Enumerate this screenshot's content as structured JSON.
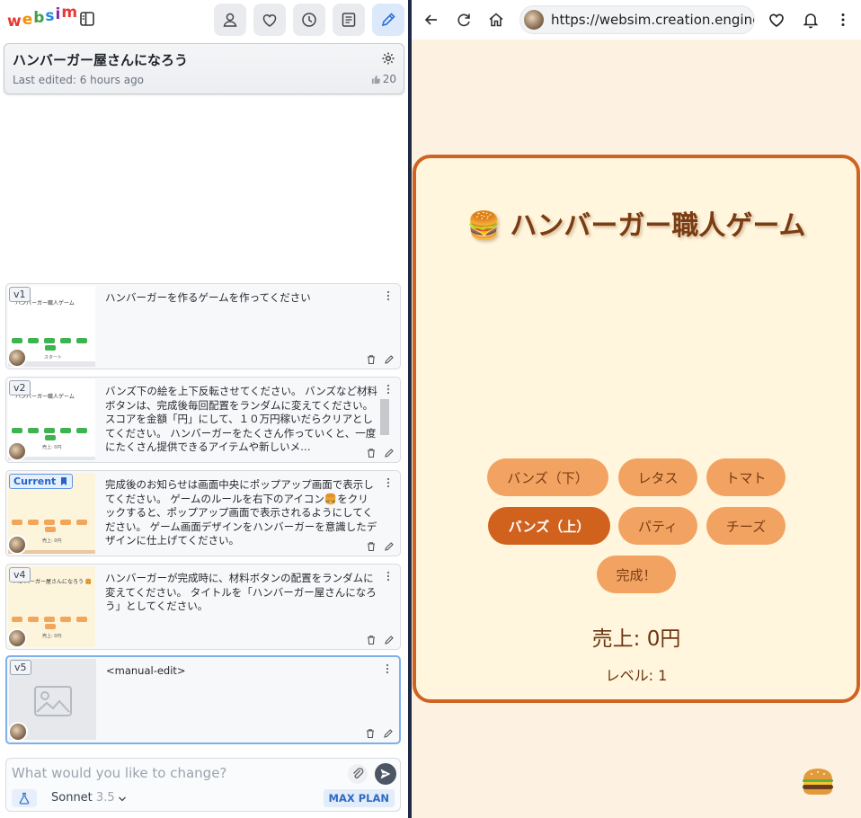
{
  "left": {
    "logo": [
      "w",
      "e",
      "b",
      "s",
      "i",
      "m"
    ],
    "project": {
      "title": "ハンバーガー屋さんになろう",
      "edited": "Last edited: 6 hours ago",
      "likes": "20"
    },
    "versions": [
      {
        "badge": "v1",
        "text": "ハンバーガーを作るゲームを作ってください",
        "thumb_title": "ハンバーガー職人ゲーム",
        "thumb_small": "スタート"
      },
      {
        "badge": "v2",
        "text": "バンズ下の絵を上下反転させてください。 バンズなど材料ボタンは、完成後毎回配置をランダムに変えてください。 スコアを金額「円」にして、１０万円稼いだらクリアとしてください。 ハンバーガーをたくさん作っていくと、一度にたくさん提供できるアイテムや新しいメ…",
        "thumb_title": "ハンバーガー職人ゲーム",
        "thumb_small": "売上: 0円"
      },
      {
        "badge": "Current",
        "text": "完成後のお知らせは画面中央にポップアップ画面で表示してください。 ゲームのルールを右下のアイコン🍔をクリックすると、ポップアップ画面で表示されるようにしてください。 ゲーム画面デザインをハンバーガーを意識したデザインに仕上げてください。",
        "thumb_title": "",
        "thumb_small": "売上: 0円"
      },
      {
        "badge": "v4",
        "text": "ハンバーガーが完成時に、材料ボタンの配置をランダムに変えてください。 タイトルを「ハンバーガー屋さんになろう」としてください。",
        "thumb_title": "ハンバーガー屋さんになろう 🍔",
        "thumb_small": "売上: 0円"
      },
      {
        "badge": "v5",
        "text": "<manual-edit>",
        "thumb_title": "",
        "thumb_small": ""
      }
    ],
    "chat": {
      "placeholder": "What would you like to change?",
      "model": "Sonnet",
      "model_version": "3.5",
      "plan": "MAX PLAN"
    }
  },
  "right": {
    "url": "https://websim.creation.engine",
    "game": {
      "title": "🍔 ハンバーガー職人ゲーム",
      "ingredients": [
        "バンズ（下）",
        "レタス",
        "トマト",
        "バンズ（上）",
        "パティ",
        "チーズ",
        "完成！"
      ],
      "selected": "バンズ（上）",
      "sales": "売上: 0円",
      "level": "レベル: 1"
    }
  },
  "colors": {
    "accent": "#d0621e",
    "button": "#f2a362",
    "frame": "#cf6422",
    "text_brown": "#7a3c12"
  },
  "icons": [
    "sidebar-toggle-icon",
    "user-icon",
    "heart-icon",
    "clock-icon",
    "document-icon",
    "pencil-icon",
    "gear-icon",
    "thumbs-up-icon",
    "trash-icon",
    "edit-icon",
    "more-icon",
    "bookmark-icon",
    "image-placeholder-icon",
    "paperclip-icon",
    "send-icon",
    "model-icon",
    "chevron-down-icon",
    "back-icon",
    "refresh-icon",
    "home-icon",
    "bell-icon",
    "hamburger-icon"
  ]
}
